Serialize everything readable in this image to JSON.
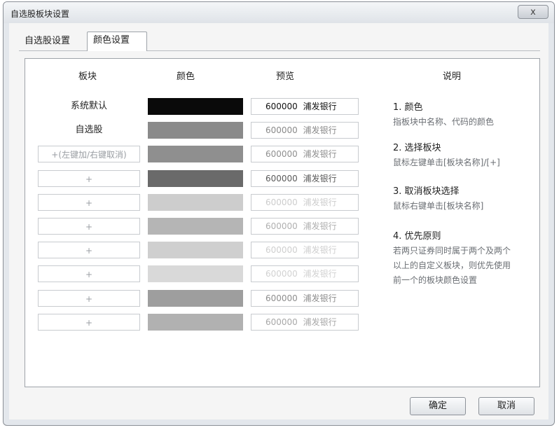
{
  "window": {
    "title": "自选股板块设置",
    "close_label": "x"
  },
  "tabs": [
    {
      "label": "自选股设置"
    },
    {
      "label": "颜色设置"
    }
  ],
  "headers": {
    "block": "板块",
    "color": "颜色",
    "preview": "预览",
    "description": "说明"
  },
  "rows": [
    {
      "name": "系统默认",
      "style": "plain",
      "color": "#0a0a0a",
      "code": "600000",
      "bank": "浦发银行",
      "text_color": "#111111"
    },
    {
      "name": "自选股",
      "style": "plain",
      "color": "#8a8a8a",
      "code": "600000",
      "bank": "浦发银行",
      "text_color": "#8a8a8a"
    },
    {
      "name": "+(左键加/右键取消)",
      "style": "hint",
      "color": "#8f8f8f",
      "code": "600000",
      "bank": "浦发银行",
      "text_color": "#8f8f8f"
    },
    {
      "name": "+",
      "style": "box",
      "color": "#6a6a6a",
      "code": "600000",
      "bank": "浦发银行",
      "text_color": "#5a5a5a"
    },
    {
      "name": "+",
      "style": "box",
      "color": "#cdcdcd",
      "code": "600000",
      "bank": "浦发银行",
      "text_color": "#cdcdcd"
    },
    {
      "name": "+",
      "style": "box",
      "color": "#b5b5b5",
      "code": "600000",
      "bank": "浦发银行",
      "text_color": "#b0b0b0"
    },
    {
      "name": "+",
      "style": "box",
      "color": "#cfcfcf",
      "code": "600000",
      "bank": "浦发银行",
      "text_color": "#cfcfcf"
    },
    {
      "name": "+",
      "style": "box",
      "color": "#d9d9d9",
      "code": "600000",
      "bank": "浦发银行",
      "text_color": "#d2d2d2"
    },
    {
      "name": "+",
      "style": "box",
      "color": "#9e9e9e",
      "code": "600000",
      "bank": "浦发银行",
      "text_color": "#8e8e8e"
    },
    {
      "name": "+",
      "style": "box",
      "color": "#b1b1b1",
      "code": "600000",
      "bank": "浦发银行",
      "text_color": "#a8a8a8"
    }
  ],
  "descriptions": [
    {
      "title": "1. 颜色",
      "text": [
        "指板块中名称、代码的颜色"
      ]
    },
    {
      "title": "2. 选择板块",
      "text": [
        "鼠标左键单击[板块名称]/[+]"
      ]
    },
    {
      "title": "3. 取消板块选择",
      "text": [
        "鼠标右键单击[板块名称]"
      ]
    },
    {
      "title": "4. 优先原则",
      "text": [
        "若两只证券同时属于两个及两个",
        "以上的自定义板块，则优先使用",
        "前一个的板块颜色设置"
      ]
    }
  ],
  "buttons": {
    "ok": "确定",
    "cancel": "取消"
  }
}
